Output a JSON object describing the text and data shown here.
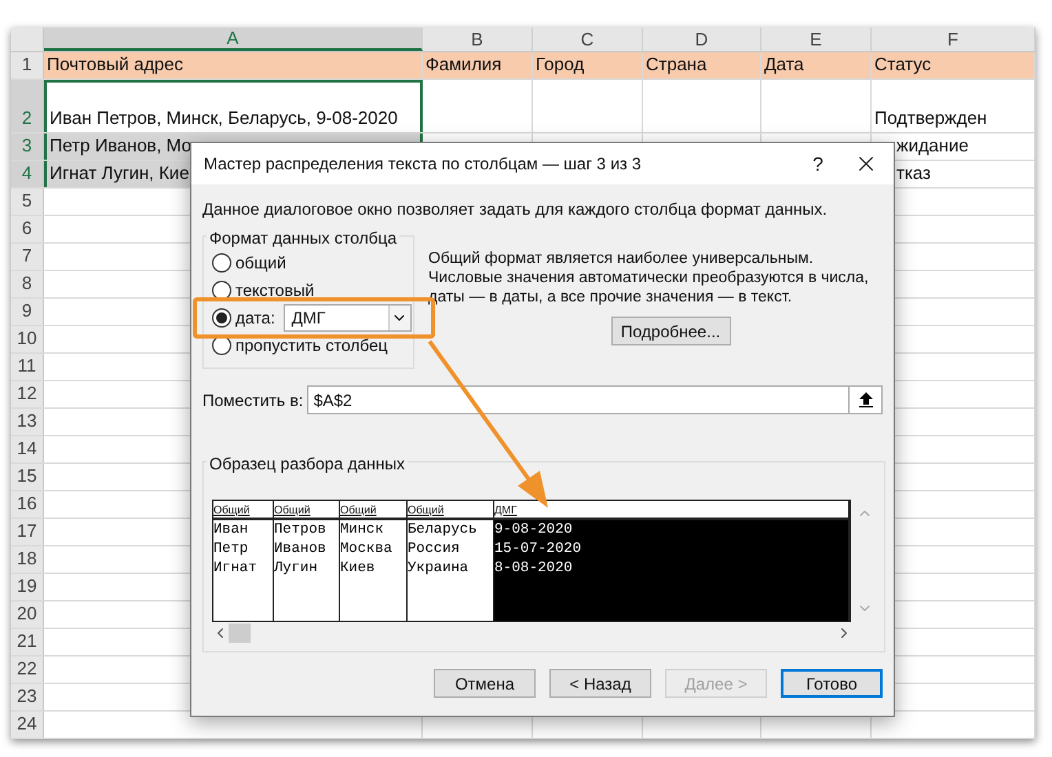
{
  "sheet": {
    "columns": [
      {
        "label": "A",
        "selected": true
      },
      {
        "label": "B",
        "selected": false
      },
      {
        "label": "C",
        "selected": false
      },
      {
        "label": "D",
        "selected": false
      },
      {
        "label": "E",
        "selected": false
      },
      {
        "label": "F",
        "selected": false
      }
    ],
    "rows": [
      {
        "number": "1",
        "kind": "header",
        "selected": false,
        "cells": {
          "A": "Почтовый адрес",
          "B": "Фамилия",
          "C": "Город",
          "D": "Страна",
          "E": "Дата",
          "F": "Статус"
        }
      },
      {
        "number": "2",
        "kind": "data",
        "selected": true,
        "cells": {
          "A": "Иван Петров, Минск, Беларусь, 9-08-2020",
          "F": "Подтвержден"
        }
      },
      {
        "number": "3",
        "kind": "data",
        "selected": true,
        "cells": {
          "A": "Петр Иванов, Мо",
          "F": "жидание"
        }
      },
      {
        "number": "4",
        "kind": "data",
        "selected": true,
        "cells": {
          "A": "Игнат Лугин, Кие",
          "F": "тказ"
        }
      },
      {
        "number": "5"
      },
      {
        "number": "6"
      },
      {
        "number": "7"
      },
      {
        "number": "8"
      },
      {
        "number": "9"
      },
      {
        "number": "10"
      },
      {
        "number": "11"
      },
      {
        "number": "12"
      },
      {
        "number": "13"
      },
      {
        "number": "14"
      },
      {
        "number": "15"
      },
      {
        "number": "16"
      },
      {
        "number": "17"
      },
      {
        "number": "18"
      },
      {
        "number": "19"
      },
      {
        "number": "20"
      },
      {
        "number": "21"
      },
      {
        "number": "22"
      },
      {
        "number": "23"
      },
      {
        "number": "24"
      }
    ]
  },
  "dialog": {
    "title": "Мастер распределения текста по столбцам — шаг 3 из 3",
    "help": "?",
    "description": "Данное диалоговое окно позволяет задать для каждого столбца формат данных.",
    "format_group": {
      "legend": "Формат данных столбца",
      "options": [
        {
          "kind": "plain",
          "label": "общий",
          "selected": false
        },
        {
          "kind": "plain",
          "label": "текстовый",
          "selected": false
        },
        {
          "kind": "date",
          "label": "дата:",
          "selected": true,
          "value": "ДМГ"
        },
        {
          "kind": "plain",
          "label": "пропустить столбец",
          "selected": false
        }
      ]
    },
    "info": "Общий формат является наиболее универсальным. Числовые значения автоматически преобразуются в числа, даты — в даты, а все прочие значения — в текст.",
    "more_button": "Подробнее...",
    "destination": {
      "label": "Поместить в:",
      "value": "$A$2"
    },
    "preview": {
      "legend": "Образец разбора данных",
      "columns": [
        {
          "header": "Общий",
          "selected": false,
          "values": [
            "Иван",
            "Петр",
            "Игнат"
          ]
        },
        {
          "header": "Общий",
          "selected": false,
          "values": [
            "Петров",
            "Иванов",
            "Лугин"
          ]
        },
        {
          "header": "Общий",
          "selected": false,
          "values": [
            "Минск",
            "Москва",
            "Киев"
          ]
        },
        {
          "header": "Общий",
          "selected": false,
          "values": [
            "Беларусь",
            "Россия",
            "Украина"
          ]
        },
        {
          "header": "ДМГ",
          "selected": true,
          "values": [
            "9-08-2020",
            "15-07-2020",
            "8-08-2020"
          ]
        }
      ]
    },
    "buttons": [
      {
        "label": "Отмена",
        "disabled": false,
        "default": false
      },
      {
        "label": "< Назад",
        "disabled": false,
        "default": false
      },
      {
        "label": "Далее >",
        "disabled": true,
        "default": false
      },
      {
        "label": "Готово",
        "disabled": false,
        "default": true
      }
    ]
  }
}
